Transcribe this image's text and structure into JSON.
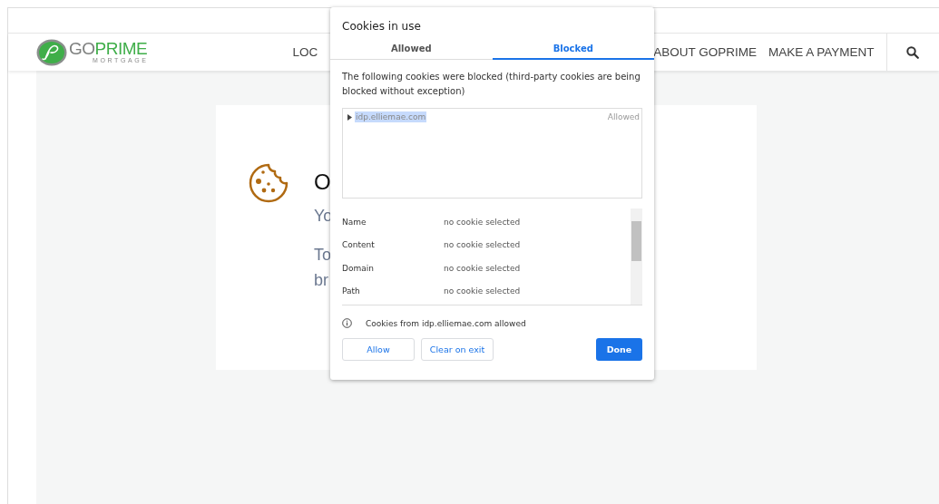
{
  "page": {
    "logo": {
      "brand_go": "GO",
      "brand_prime": "PRIME",
      "tagline": "MORTGAGE"
    },
    "nav": [
      "LOC",
      "ABOUT GOPRIME",
      "MAKE A PAYMENT"
    ],
    "card": {
      "heading": "O",
      "lines": [
        "Yo",
        "To",
        "br"
      ]
    }
  },
  "dialog": {
    "title": "Cookies in use",
    "tabs": [
      {
        "label": "Allowed",
        "selected": false
      },
      {
        "label": "Blocked",
        "selected": true
      }
    ],
    "message": "The following cookies were blocked (third-party cookies are being blocked without exception)",
    "cookie_list": [
      {
        "domain": "idp.elliemae.com",
        "status": "Allowed",
        "selected": true,
        "expanded": false
      }
    ],
    "details": [
      {
        "label": "Name",
        "value": "no cookie selected"
      },
      {
        "label": "Content",
        "value": "no cookie selected"
      },
      {
        "label": "Domain",
        "value": "no cookie selected"
      },
      {
        "label": "Path",
        "value": "no cookie selected"
      }
    ],
    "info": "Cookies from idp.elliemae.com allowed",
    "buttons": [
      {
        "label": "Allow",
        "kind": "secondary"
      },
      {
        "label": "Clear on exit",
        "kind": "secondary"
      },
      {
        "label": "Done",
        "kind": "primary"
      }
    ]
  }
}
